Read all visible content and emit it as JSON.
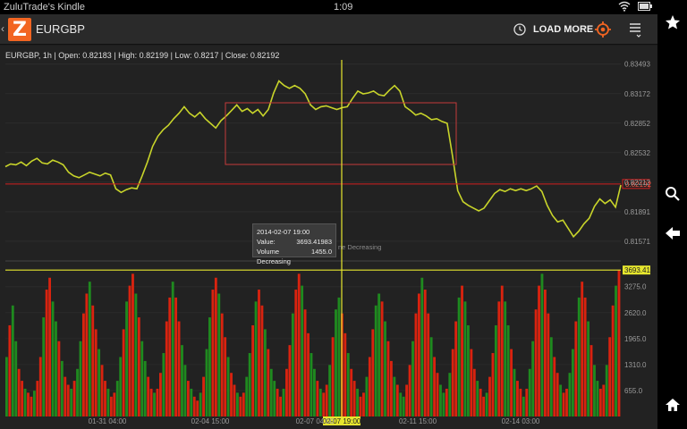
{
  "status_bar": {
    "app_name": "ZuluTrade's Kindle",
    "time": "1:09",
    "icons": [
      "wifi-icon",
      "battery-icon"
    ]
  },
  "action_bar": {
    "title": "EURGBP",
    "load_more_label": "LOAD MORE",
    "icons": [
      "back-chevron-icon",
      "zulutrade-logo",
      "history-icon",
      "target-icon",
      "menu-icon"
    ]
  },
  "system_bar": {
    "icons": [
      "star-icon",
      "search-icon",
      "back-arrow-icon",
      "home-icon"
    ]
  },
  "chart_info": {
    "symbol_interval": "EURGBP, 1h",
    "open": "Open: 0.82183",
    "high": "High: 0.82199",
    "low": "Low: 0.8217",
    "close": "Close: 0.82192",
    "full_text": "EURGBP, 1h | Open: 0.82183 | High: 0.82199 | Low: 0.8217 | Close: 0.82192"
  },
  "tooltip": {
    "date": "2014-02-07 19:00",
    "value_label": "Value:",
    "value": "3693.41983",
    "vol_label": "Volume Decreasing",
    "vol_value": "1455.0",
    "extra_text": "ne Decreasing"
  },
  "colors": {
    "price_line": "#c8d42a",
    "volume_up": "#1f8a1f",
    "volume_down": "#d9230f",
    "crosshair": "#e6e62e",
    "current_price_line": "#d22020",
    "accent": "#f26522"
  },
  "chart_data": [
    {
      "type": "line",
      "title": "EURGBP, 1h",
      "x_ticks": [
        "01-31 04:00",
        "02-04 15:00",
        "02-07 04:00",
        "02-11 15:00",
        "02-14 03:00"
      ],
      "y_ticks": [
        "0.83493",
        "0.83172",
        "0.82852",
        "0.82532",
        "0.82212",
        "0.81891",
        "0.81571"
      ],
      "ylim": [
        0.8157,
        0.8349
      ],
      "current_price_label": "0.82192",
      "points": [
        0.8238,
        0.8241,
        0.824,
        0.8243,
        0.8239,
        0.8244,
        0.8247,
        0.8242,
        0.8241,
        0.8245,
        0.8243,
        0.824,
        0.8232,
        0.8228,
        0.8226,
        0.8229,
        0.8232,
        0.823,
        0.8228,
        0.8231,
        0.8229,
        0.8214,
        0.821,
        0.8213,
        0.8215,
        0.8214,
        0.8228,
        0.8243,
        0.826,
        0.8271,
        0.8278,
        0.8283,
        0.829,
        0.8296,
        0.8303,
        0.8296,
        0.8292,
        0.8297,
        0.829,
        0.8285,
        0.828,
        0.8288,
        0.8293,
        0.8299,
        0.8305,
        0.8298,
        0.8301,
        0.8296,
        0.83,
        0.8293,
        0.83,
        0.8318,
        0.8331,
        0.8326,
        0.8323,
        0.8326,
        0.8323,
        0.8317,
        0.8305,
        0.83,
        0.8303,
        0.8304,
        0.8302,
        0.83,
        0.8302,
        0.8303,
        0.8312,
        0.832,
        0.8317,
        0.8318,
        0.832,
        0.8316,
        0.8315,
        0.8321,
        0.8326,
        0.832,
        0.8303,
        0.8299,
        0.8294,
        0.8296,
        0.8293,
        0.8289,
        0.829,
        0.8287,
        0.8285,
        0.825,
        0.8212,
        0.82,
        0.8196,
        0.8193,
        0.819,
        0.8193,
        0.8201,
        0.8209,
        0.8213,
        0.8211,
        0.8214,
        0.8212,
        0.8214,
        0.8212,
        0.8214,
        0.8217,
        0.8211,
        0.8196,
        0.8185,
        0.8178,
        0.818,
        0.8171,
        0.8162,
        0.8168,
        0.8176,
        0.8182,
        0.8195,
        0.8203,
        0.8198,
        0.8202,
        0.8194,
        0.8218
      ]
    },
    {
      "type": "bar",
      "title": "Volume",
      "y_ticks": [
        "3275.0",
        "2620.0",
        "1965.0",
        "1310.0",
        "655.0"
      ],
      "ylim": [
        0,
        3900
      ],
      "current_value_label": "3693.4198",
      "values": [
        1500,
        2300,
        2800,
        1900,
        1200,
        900,
        700,
        600,
        500,
        650,
        900,
        1500,
        2500,
        3200,
        3500,
        2900,
        2400,
        1900,
        1400,
        1000,
        800,
        700,
        900,
        1200,
        1900,
        2600,
        3100,
        3400,
        2800,
        2200,
        1700,
        1300,
        900,
        700,
        500,
        600,
        900,
        1500,
        2200,
        2900,
        3300,
        3600,
        3100,
        2500,
        1900,
        1400,
        1000,
        700,
        600,
        700,
        1100,
        1600,
        2400,
        3000,
        3400,
        3000,
        2400,
        1800,
        1300,
        900,
        700,
        500,
        400,
        600,
        1000,
        1700,
        2500,
        3200,
        3500,
        3100,
        2600,
        2000,
        1500,
        1100,
        800,
        600,
        500,
        600,
        1000,
        1600,
        2300,
        2900,
        3200,
        2800,
        2200,
        1700,
        1200,
        900,
        700,
        500,
        700,
        1200,
        1800,
        2600,
        3200,
        3600,
        3300,
        2700,
        2100,
        1600,
        1200,
        900,
        700,
        600,
        800,
        1300,
        2000,
        2700,
        3000,
        2600,
        2100,
        1600,
        1200,
        900,
        700,
        500,
        600,
        1000,
        1500,
        2200,
        2800,
        3100,
        2900,
        2400,
        1900,
        1400,
        1000,
        800,
        600,
        500,
        800,
        1300,
        1900,
        2600,
        3100,
        3500,
        3200,
        2600,
        2000,
        1500,
        1100,
        800,
        600,
        700,
        1100,
        1700,
        2400,
        3000,
        3300,
        2900,
        2300,
        1700,
        1200,
        900,
        700,
        500,
        600,
        1000,
        1600,
        2300,
        2900,
        3300,
        2900,
        2300,
        1700,
        1200,
        900,
        700,
        500,
        700,
        1200,
        1900,
        2700,
        3300,
        3600,
        3200,
        2600,
        2000,
        1500,
        1100,
        800,
        600,
        700,
        1100,
        1700,
        2400,
        3000,
        3400,
        3000,
        2400,
        1800,
        1300,
        900,
        700,
        800,
        1300,
        2000,
        2800,
        3300,
        3700
      ]
    }
  ]
}
